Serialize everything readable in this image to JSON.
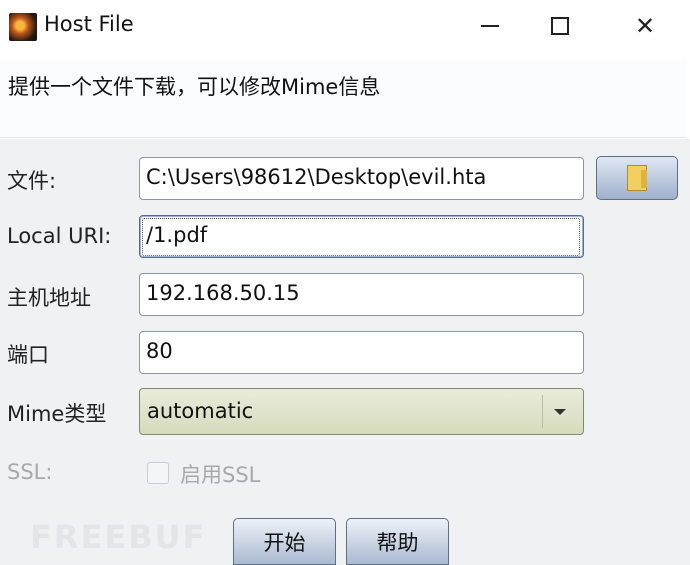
{
  "window": {
    "title": "Host File",
    "app_icon": "app-icon",
    "minimize_icon": "minimize-icon",
    "maximize_icon": "maximize-icon",
    "close_icon": "close-icon",
    "close_glyph": "✕"
  },
  "description": "提供一个文件下载，可以修改Mime信息",
  "form": {
    "file": {
      "label": "文件:",
      "value": "C:\\Users\\98612\\Desktop\\evil.hta",
      "browse_icon": "folder-icon"
    },
    "uri": {
      "label": "Local URI:",
      "value": "/1.pdf"
    },
    "host": {
      "label": "主机地址",
      "value": "192.168.50.15"
    },
    "port": {
      "label": "端口",
      "value": "80"
    },
    "mime": {
      "label": "Mime类型",
      "value": "automatic",
      "arrow_icon": "dropdown-arrow-icon"
    },
    "ssl": {
      "label": "SSL:",
      "checkbox_label": "启用SSL",
      "checked": false,
      "disabled": true
    }
  },
  "buttons": {
    "start": "开始",
    "help": "帮助"
  },
  "watermark": "FREEBUF",
  "colors": {
    "form_bg": "#f0f1f3",
    "select_bg": "#dfe3c9",
    "button_gradient_bottom": "#a9b9d0",
    "disabled_text": "#a7a9ad"
  }
}
